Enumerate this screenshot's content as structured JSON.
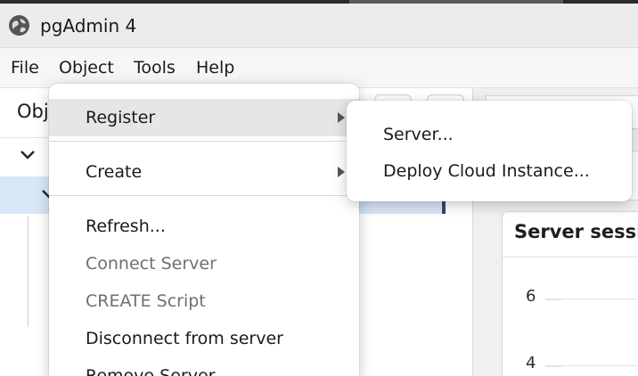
{
  "window": {
    "title": "pgAdmin 4",
    "icon": "pgadmin-globe-icon"
  },
  "menubar": {
    "items": [
      "File",
      "Object",
      "Tools",
      "Help"
    ]
  },
  "left_panel": {
    "tab_label": "Obj"
  },
  "object_menu": {
    "items": [
      {
        "label": "Register",
        "has_submenu": true,
        "state": "hover"
      },
      {
        "label": "Create",
        "has_submenu": true,
        "state": "normal"
      },
      {
        "label": "Refresh...",
        "has_submenu": false,
        "state": "normal"
      },
      {
        "label": "Connect Server",
        "has_submenu": false,
        "state": "disabled"
      },
      {
        "label": "CREATE Script",
        "has_submenu": false,
        "state": "disabled"
      },
      {
        "label": "Disconnect from server",
        "has_submenu": false,
        "state": "normal"
      },
      {
        "label": "Remove Server",
        "has_submenu": false,
        "state": "normal"
      }
    ]
  },
  "register_submenu": {
    "items": [
      "Server...",
      "Deploy Cloud Instance..."
    ]
  },
  "dashboard": {
    "card_title": "Server sessio",
    "y_ticks": [
      "6",
      "4"
    ]
  },
  "colors": {
    "selection": "#d8e8f6",
    "selection_bar": "#2e4b66",
    "menu_hover": "#e6e6e6",
    "disabled_text": "#6f6f6f"
  }
}
